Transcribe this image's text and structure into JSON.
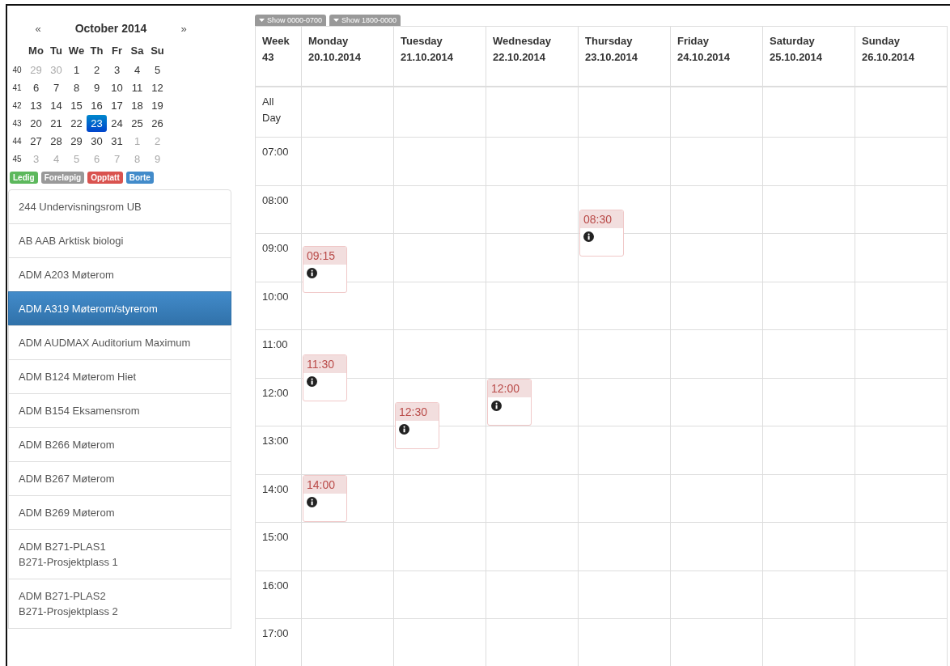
{
  "calendar": {
    "prev": "«",
    "title": "October 2014",
    "next": "»",
    "weekdays": [
      "Mo",
      "Tu",
      "We",
      "Th",
      "Fr",
      "Sa",
      "Su"
    ],
    "weeks": [
      {
        "number": "40",
        "days": [
          {
            "label": "29",
            "muted": true,
            "selected": false
          },
          {
            "label": "30",
            "muted": true,
            "selected": false
          },
          {
            "label": "1",
            "muted": false,
            "selected": false
          },
          {
            "label": "2",
            "muted": false,
            "selected": false
          },
          {
            "label": "3",
            "muted": false,
            "selected": false
          },
          {
            "label": "4",
            "muted": false,
            "selected": false
          },
          {
            "label": "5",
            "muted": false,
            "selected": false
          }
        ]
      },
      {
        "number": "41",
        "days": [
          {
            "label": "6",
            "muted": false,
            "selected": false
          },
          {
            "label": "7",
            "muted": false,
            "selected": false
          },
          {
            "label": "8",
            "muted": false,
            "selected": false
          },
          {
            "label": "9",
            "muted": false,
            "selected": false
          },
          {
            "label": "10",
            "muted": false,
            "selected": false
          },
          {
            "label": "11",
            "muted": false,
            "selected": false
          },
          {
            "label": "12",
            "muted": false,
            "selected": false
          }
        ]
      },
      {
        "number": "42",
        "days": [
          {
            "label": "13",
            "muted": false,
            "selected": false
          },
          {
            "label": "14",
            "muted": false,
            "selected": false
          },
          {
            "label": "15",
            "muted": false,
            "selected": false
          },
          {
            "label": "16",
            "muted": false,
            "selected": false
          },
          {
            "label": "17",
            "muted": false,
            "selected": false
          },
          {
            "label": "18",
            "muted": false,
            "selected": false
          },
          {
            "label": "19",
            "muted": false,
            "selected": false
          }
        ]
      },
      {
        "number": "43",
        "days": [
          {
            "label": "20",
            "muted": false,
            "selected": false
          },
          {
            "label": "21",
            "muted": false,
            "selected": false
          },
          {
            "label": "22",
            "muted": false,
            "selected": false
          },
          {
            "label": "23",
            "muted": false,
            "selected": true
          },
          {
            "label": "24",
            "muted": false,
            "selected": false
          },
          {
            "label": "25",
            "muted": false,
            "selected": false
          },
          {
            "label": "26",
            "muted": false,
            "selected": false
          }
        ]
      },
      {
        "number": "44",
        "days": [
          {
            "label": "27",
            "muted": false,
            "selected": false
          },
          {
            "label": "28",
            "muted": false,
            "selected": false
          },
          {
            "label": "29",
            "muted": false,
            "selected": false
          },
          {
            "label": "30",
            "muted": false,
            "selected": false
          },
          {
            "label": "31",
            "muted": false,
            "selected": false
          },
          {
            "label": "1",
            "muted": true,
            "selected": false
          },
          {
            "label": "2",
            "muted": true,
            "selected": false
          }
        ]
      },
      {
        "number": "45",
        "days": [
          {
            "label": "3",
            "muted": true,
            "selected": false
          },
          {
            "label": "4",
            "muted": true,
            "selected": false
          },
          {
            "label": "5",
            "muted": true,
            "selected": false
          },
          {
            "label": "6",
            "muted": true,
            "selected": false
          },
          {
            "label": "7",
            "muted": true,
            "selected": false
          },
          {
            "label": "8",
            "muted": true,
            "selected": false
          },
          {
            "label": "9",
            "muted": true,
            "selected": false
          }
        ]
      }
    ]
  },
  "legend": [
    {
      "label": "Ledig",
      "color": "#5cb85c"
    },
    {
      "label": "Foreløpig",
      "color": "#999999"
    },
    {
      "label": "Opptatt",
      "color": "#d9534f"
    },
    {
      "label": "Borte",
      "color": "#428bca"
    }
  ],
  "rooms": [
    {
      "label": "244 Undervisningsrom UB",
      "selected": false
    },
    {
      "label": "AB AAB Arktisk biologi",
      "selected": false
    },
    {
      "label": "ADM A203 Møterom",
      "selected": false
    },
    {
      "label": "ADM A319 Møterom/styrerom",
      "selected": true
    },
    {
      "label": "ADM AUDMAX Auditorium Maximum",
      "selected": false
    },
    {
      "label": "ADM B124 Møterom Hiet",
      "selected": false
    },
    {
      "label": "ADM B154 Eksamensrom",
      "selected": false
    },
    {
      "label": "ADM B266 Møterom",
      "selected": false
    },
    {
      "label": "ADM B267 Møterom",
      "selected": false
    },
    {
      "label": "ADM B269 Møterom",
      "selected": false
    },
    {
      "label": "ADM B271-PLAS1\nB271-Prosjektplass 1",
      "selected": false
    },
    {
      "label": "ADM B271-PLAS2\nB271-Prosjektplass 2",
      "selected": false
    }
  ],
  "toggles": [
    "Show 0000-0700",
    "Show 1800-0000"
  ],
  "week": {
    "label": "Week",
    "number": "43"
  },
  "all_day": "All Day",
  "hours": [
    "07:00",
    "08:00",
    "09:00",
    "10:00",
    "11:00",
    "12:00",
    "13:00",
    "14:00",
    "15:00",
    "16:00",
    "17:00"
  ],
  "days": [
    {
      "name": "Monday",
      "date": "20.10.2014",
      "events": [
        {
          "start": "09:15"
        },
        {
          "start": "11:30"
        },
        {
          "start": "14:00"
        }
      ]
    },
    {
      "name": "Tuesday",
      "date": "21.10.2014",
      "events": [
        {
          "start": "12:30"
        }
      ]
    },
    {
      "name": "Wednesday",
      "date": "22.10.2014",
      "events": [
        {
          "start": "12:00"
        }
      ]
    },
    {
      "name": "Thursday",
      "date": "23.10.2014",
      "events": [
        {
          "start": "08:30"
        }
      ]
    },
    {
      "name": "Friday",
      "date": "24.10.2014"
    },
    {
      "name": "Saturday",
      "date": "25.10.2014"
    },
    {
      "name": "Sunday",
      "date": "26.10.2014"
    }
  ]
}
